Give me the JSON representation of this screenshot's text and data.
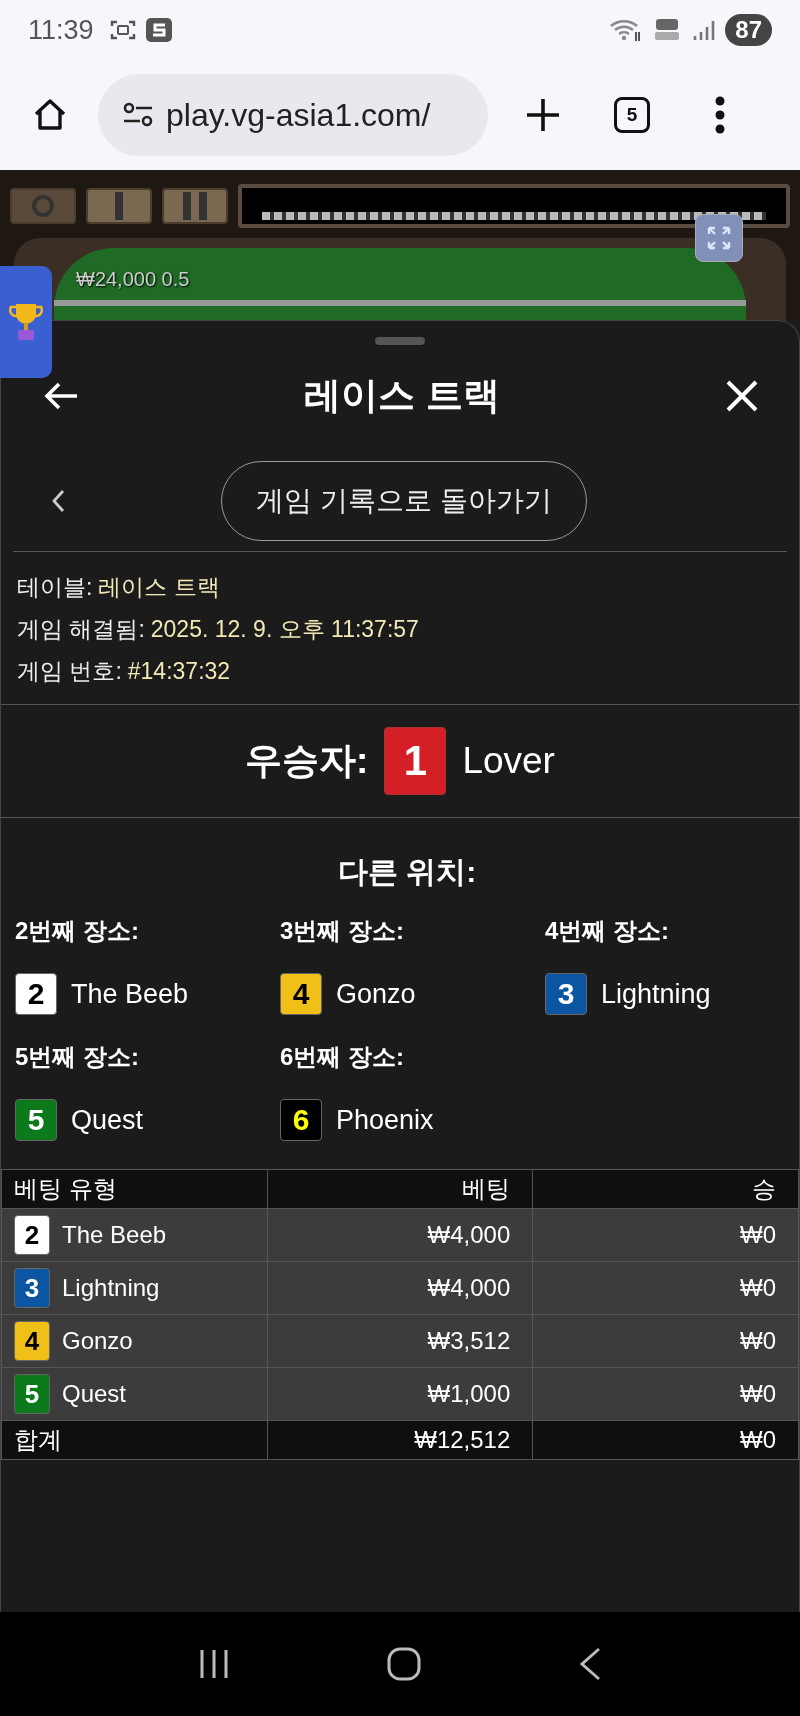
{
  "status_bar": {
    "time": "11:39",
    "battery": "87"
  },
  "browser": {
    "url": "play.vg-asia1.com/",
    "tab_count": "5"
  },
  "game": {
    "labels": [
      "₩24,000 0.5"
    ]
  },
  "sheet": {
    "title": "레이스 트랙",
    "back_button": "게임 기록으로 돌아가기",
    "info": [
      {
        "label": "테이블:",
        "value": "레이스 트랙"
      },
      {
        "label": "게임 해결됨:",
        "value": "2025. 12. 9. 오후 11:37:57"
      },
      {
        "label": "게임 번호:",
        "value": "#14:37:32"
      }
    ],
    "winner": {
      "label": "우승자:",
      "horse": {
        "number": {
          "text": "1",
          "color": "#ffffff"
        },
        "name": "Lover",
        "color": "#d41f26"
      }
    },
    "other_positions": {
      "title": "다른 위치:",
      "places": [
        {
          "label": "2번째 장소:",
          "horse": {
            "number": {
              "text": "2",
              "color": "#000000"
            },
            "name": "The Beeb",
            "color": "#ffffff"
          }
        },
        {
          "label": "3번째 장소:",
          "horse": {
            "number": {
              "text": "4",
              "color": "#000000"
            },
            "name": "Gonzo",
            "color": "#f0c018"
          }
        },
        {
          "label": "4번째 장소:",
          "horse": {
            "number": {
              "text": "3",
              "color": "#ffffff"
            },
            "name": "Lightning",
            "color": "#0b55a3"
          }
        },
        {
          "label": "5번째 장소:",
          "horse": {
            "number": {
              "text": "5",
              "color": "#ffffff"
            },
            "name": "Quest",
            "color": "#0c7a1a"
          }
        },
        {
          "label": "6번째 장소:",
          "horse": {
            "number": {
              "text": "6",
              "color": "#ffff00"
            },
            "name": "Phoenix",
            "color": "#000000"
          }
        }
      ]
    },
    "bets_table": {
      "columns": [
        "베팅 유형",
        "베팅",
        "승"
      ],
      "rows": [
        {
          "horse": {
            "number": {
              "text": "2",
              "color": "#000000"
            },
            "name": "The Beeb",
            "color": "#ffffff"
          },
          "bet": "₩4,000",
          "win": "₩0"
        },
        {
          "horse": {
            "number": {
              "text": "3",
              "color": "#ffffff"
            },
            "name": "Lightning",
            "color": "#0b55a3"
          },
          "bet": "₩4,000",
          "win": "₩0"
        },
        {
          "horse": {
            "number": {
              "text": "4",
              "color": "#000000"
            },
            "name": "Gonzo",
            "color": "#f0c018"
          },
          "bet": "₩3,512",
          "win": "₩0"
        },
        {
          "horse": {
            "number": {
              "text": "5",
              "color": "#ffffff"
            },
            "name": "Quest",
            "color": "#0c7a1a"
          },
          "bet": "₩1,000",
          "win": "₩0"
        }
      ],
      "total": {
        "label": "합계",
        "bet": "₩12,512",
        "win": "₩0"
      }
    }
  }
}
